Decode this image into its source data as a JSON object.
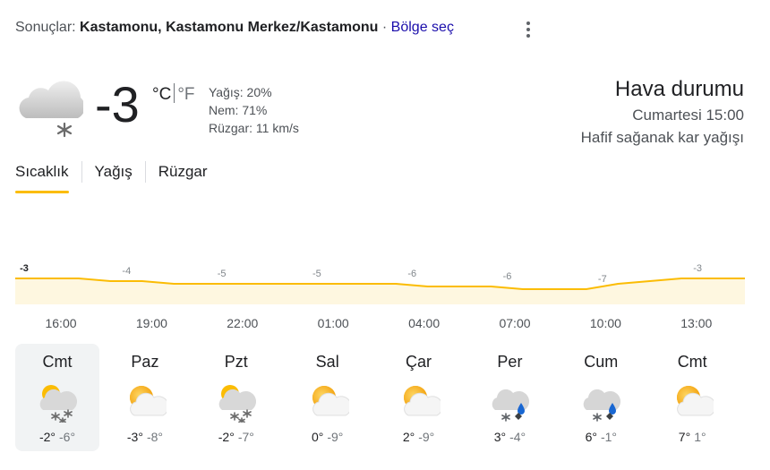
{
  "header": {
    "prefix": "Sonuçlar: ",
    "location": "Kastamonu, Kastamonu Merkez/Kastamonu",
    "separator": " · ",
    "region_link": "Bölge seç",
    "menu_icon": "more-vert-icon"
  },
  "current": {
    "icon": "cloud-snow-icon",
    "temp": "-3",
    "unit_c": "°C",
    "unit_f": "°F",
    "precip": "Yağış: 20%",
    "humidity": "Nem: 71%",
    "wind": "Rüzgar: 11 km/s",
    "title": "Hava durumu",
    "datetime": "Cumartesi 15:00",
    "condition": "Hafif sağanak kar yağışı"
  },
  "tabs": [
    "Sıcaklık",
    "Yağış",
    "Rüzgar"
  ],
  "active_tab": "Sıcaklık",
  "chart_data": {
    "type": "area",
    "x": [
      "16:00",
      "17:00",
      "18:00",
      "19:00",
      "20:00",
      "21:00",
      "22:00",
      "23:00",
      "00:00",
      "01:00",
      "02:00",
      "03:00",
      "04:00",
      "05:00",
      "06:00",
      "07:00",
      "08:00",
      "09:00",
      "10:00",
      "11:00",
      "12:00",
      "13:00",
      "14:00",
      "15:00"
    ],
    "values": [
      -3,
      -3,
      -3,
      -4,
      -4,
      -5,
      -5,
      -5,
      -5,
      -5,
      -5,
      -5,
      -5,
      -6,
      -6,
      -6,
      -7,
      -7,
      -7,
      -5,
      -4,
      -3,
      -3,
      -3
    ],
    "labels": [
      "-3",
      "-4",
      "-5",
      "-5",
      "-6",
      "-6",
      "-7",
      "-3"
    ],
    "label_index": [
      0,
      3,
      6,
      9,
      12,
      15,
      18,
      21
    ],
    "tick_labels": [
      "16:00",
      "19:00",
      "22:00",
      "01:00",
      "04:00",
      "07:00",
      "10:00",
      "13:00"
    ],
    "line_color": "#fbbc04",
    "fill_color": "#fef7e0"
  },
  "days": [
    {
      "name": "Cmt",
      "hi": "-2°",
      "lo": "-6°",
      "icon": "partly-cloudy-snow-icon",
      "selected": true
    },
    {
      "name": "Paz",
      "hi": "-3°",
      "lo": "-8°",
      "icon": "partly-cloudy-icon"
    },
    {
      "name": "Pzt",
      "hi": "-2°",
      "lo": "-7°",
      "icon": "partly-cloudy-snow-icon"
    },
    {
      "name": "Sal",
      "hi": "0°",
      "lo": "-9°",
      "icon": "partly-cloudy-icon"
    },
    {
      "name": "Çar",
      "hi": "2°",
      "lo": "-9°",
      "icon": "partly-cloudy-icon"
    },
    {
      "name": "Per",
      "hi": "3°",
      "lo": "-4°",
      "icon": "cloud-sleet-icon"
    },
    {
      "name": "Cum",
      "hi": "6°",
      "lo": "-1°",
      "icon": "cloud-sleet-icon"
    },
    {
      "name": "Cmt",
      "hi": "7°",
      "lo": "1°",
      "icon": "partly-cloudy-icon"
    }
  ]
}
